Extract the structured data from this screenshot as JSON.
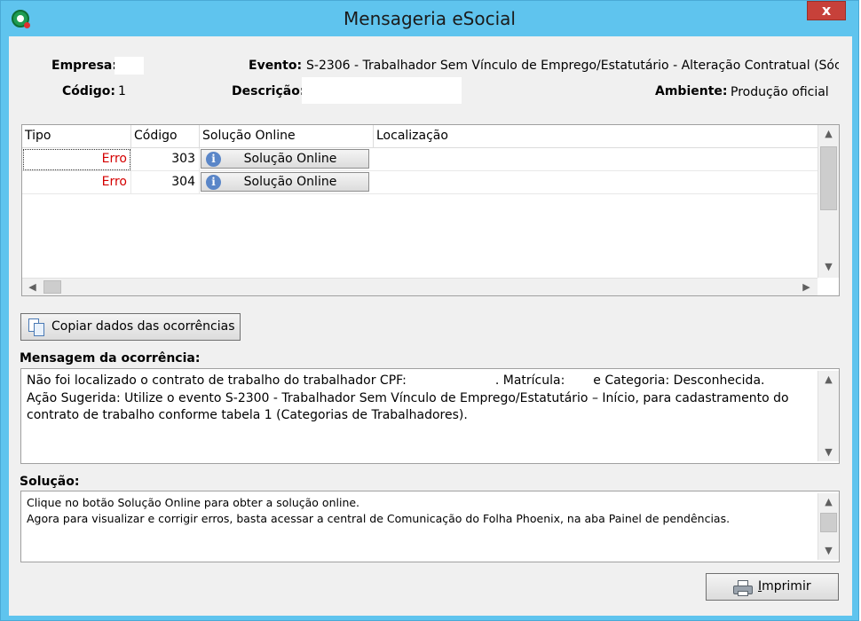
{
  "window": {
    "title": "Mensageria eSocial",
    "close_glyph": "x"
  },
  "header": {
    "empresa_label": "Empresa:",
    "empresa_value": "",
    "codigo_label": "Código:",
    "codigo_value": "1",
    "evento_label": "Evento:",
    "evento_value": "S-2306 - Trabalhador Sem Vínculo de Emprego/Estatutário - Alteração Contratual (Sóc",
    "descricao_label": "Descrição:",
    "descricao_value": "",
    "ambiente_label": "Ambiente:",
    "ambiente_value": "Produção oficial"
  },
  "grid": {
    "columns": [
      "Tipo",
      "Código",
      "Solução Online",
      "Localização"
    ],
    "rows": [
      {
        "tipo": "Erro",
        "codigo": "303",
        "solucao": "Solução Online",
        "localizacao": ""
      },
      {
        "tipo": "Erro",
        "codigo": "304",
        "solucao": "Solução Online",
        "localizacao": ""
      }
    ]
  },
  "copy_button": {
    "label": "Copiar dados das ocorrências"
  },
  "mensagem": {
    "label": "Mensagem da ocorrência:",
    "line1_a": "Não foi localizado o contrato de trabalho do trabalhador CPF:",
    "line1_b": ". Matrícula:",
    "line1_c": "e Categoria: Desconhecida.",
    "line2": "Ação Sugerida: Utilize o evento S-2300 - Trabalhador Sem Vínculo de Emprego/Estatutário – Início, para cadastramento do",
    "line3": "contrato de trabalho conforme tabela 1 (Categorias de Trabalhadores)."
  },
  "solucao": {
    "label": "Solução:",
    "line1": "Clique no botão Solução Online para obter a solução online.",
    "line2": "Agora para visualizar e corrigir erros, basta acessar a central de Comunicação do Folha Phoenix, na aba Painel de pendências."
  },
  "print_button": {
    "label_underlined": "I",
    "label_rest": "mprimir"
  },
  "icons": {
    "app": "esocial-app-icon",
    "info": "info-icon",
    "copy": "copy-icon",
    "printer": "printer-icon"
  },
  "colors": {
    "titlebar": "#5fc4ee",
    "close": "#c7413a",
    "error_text": "#d40000"
  }
}
